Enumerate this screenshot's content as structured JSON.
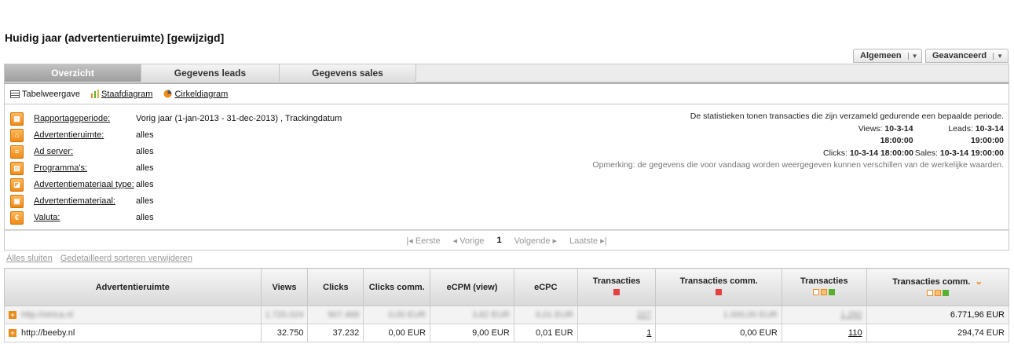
{
  "header": {
    "title": "Huidig jaar (advertentieruimte) [gewijzigd]"
  },
  "top_buttons": {
    "algemeen": "Algemeen",
    "geavanceerd": "Geavanceerd"
  },
  "tabs": [
    "Overzicht",
    "Gegevens leads",
    "Gegevens sales"
  ],
  "views": {
    "tabel": "Tabelweergave",
    "staaf": "Staafdiagram",
    "cirkel": "Cirkeldiagram"
  },
  "filters": [
    {
      "label": "Rapportageperiode:",
      "value": "Vorig jaar (1-jan-2013 - 31-dec-2013) , Trackingdatum",
      "icon": "calendar-icon"
    },
    {
      "label": "Advertentieruimte:",
      "value": "alles",
      "icon": "house-icon"
    },
    {
      "label": "Ad server:",
      "value": "alles",
      "icon": "server-icon"
    },
    {
      "label": "Programma's:",
      "value": "alles",
      "icon": "grid-icon"
    },
    {
      "label": "Advertentiemateriaal type:",
      "value": "alles",
      "icon": "material-type-icon"
    },
    {
      "label": "Advertentiemateriaal:",
      "value": "alles",
      "icon": "material-icon"
    },
    {
      "label": "Valuta:",
      "value": "alles",
      "icon": "euro-icon"
    }
  ],
  "stats": {
    "intro": "De statistieken tonen transacties die zijn verzameld gedurende een bepaalde periode.",
    "views_label": "Views:",
    "views_value": "10-3-14 18:00:00",
    "leads_label": "Leads:",
    "leads_value": "10-3-14 19:00:00",
    "clicks_label": "Clicks:",
    "clicks_value": "10-3-14 18:00:00",
    "sales_label": "Sales:",
    "sales_value": "10-3-14 19:00:00",
    "note": "Opmerking: de gegevens die voor vandaag worden weergegeven kunnen verschillen van de werkelijke waarden."
  },
  "pager": {
    "first": "Eerste",
    "prev": "Vorige",
    "current": "1",
    "next": "Volgende",
    "last": "Laatste"
  },
  "links": {
    "close_all": "Alles sluiten",
    "remove_sort": "Gedetailleerd sorteren verwijderen"
  },
  "table": {
    "headers": [
      "Advertentieruimte",
      "Views",
      "Clicks",
      "Clicks comm.",
      "eCPM (view)",
      "eCPC",
      "Transacties",
      "Transacties comm.",
      "Transacties",
      "Transacties comm."
    ],
    "rows": [
      {
        "site": "http://otrica.nl",
        "views": "1.720.024",
        "clicks": "907.468",
        "clicks_comm": "0,00 EUR",
        "ecpm": "3,82 EUR",
        "ecpc": "0,01 EUR",
        "trans": "227",
        "trans_comm": "1.000,00 EUR",
        "trans2": "1.292",
        "trans_comm2": "6.771,96 EUR"
      },
      {
        "site": "http://beeby.nl",
        "views": "32.750",
        "clicks": "37.232",
        "clicks_comm": "0,00 EUR",
        "ecpm": "9,00 EUR",
        "ecpc": "0,01 EUR",
        "trans": "1",
        "trans_comm": "0,00 EUR",
        "trans2": "110",
        "trans_comm2": "294,74 EUR"
      }
    ]
  },
  "colors": {
    "accent": "#f08a18",
    "red": "#e54040",
    "green": "#58b030"
  }
}
